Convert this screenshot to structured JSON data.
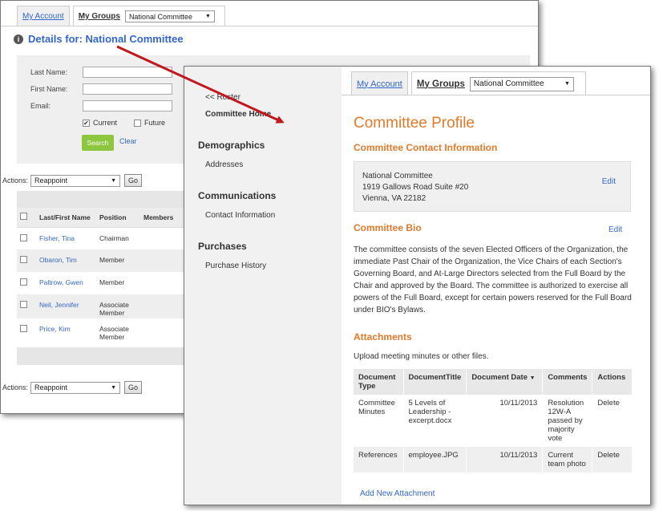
{
  "back": {
    "tabs": {
      "my_account": "My Account",
      "my_groups": "My Groups",
      "group_select": "National Committee"
    },
    "details_title": "Details for: National Committee",
    "form": {
      "last_name_label": "Last Name:",
      "first_name_label": "First Name:",
      "email_label": "Email:",
      "current_label": "Current",
      "future_label": "Future",
      "search_label": "Search",
      "clear_label": "Clear"
    },
    "actions_label": "Actions:",
    "actions_value": "Reappoint",
    "go_label": "Go",
    "table": {
      "headers": [
        "Last/First Name",
        "Position",
        "Members"
      ],
      "rows": [
        {
          "name": "Fisher, Tina",
          "position": "Chairman"
        },
        {
          "name": "Obaron, Tim",
          "position": "Member"
        },
        {
          "name": "Paltrow, Gwen",
          "position": "Member"
        },
        {
          "name": "Neil, Jennifer",
          "position": "Associate Member"
        },
        {
          "name": "Price, Kim",
          "position": "Associate Member"
        }
      ]
    }
  },
  "front": {
    "tabs": {
      "my_account": "My Account",
      "my_groups": "My Groups",
      "group_select": "National Committee"
    },
    "sidebar": {
      "roster": "<< Roster",
      "committee_home": "Committee Home",
      "demographics": "Demographics",
      "addresses": "Addresses",
      "communications": "Communications",
      "contact_information": "Contact Information",
      "purchases": "Purchases",
      "purchase_history": "Purchase History"
    },
    "title": "Committee Profile",
    "contact": {
      "heading": "Committee Contact Information",
      "name": "National Committee",
      "address1": "1919 Gallows Road Suite #20",
      "address2": "Vienna, VA 22182",
      "edit": "Edit"
    },
    "bio": {
      "heading": "Committee Bio",
      "edit": "Edit",
      "text": "The committee consists of the seven Elected Officers of the Organization, the immediate Past Chair of the Organization, the Vice Chairs of each Section's Governing Board, and At-Large Directors selected from the Full Board by the Chair and approved by the Board. The committee is authorized to exercise all powers of the Full Board, except for certain powers reserved for the Full Board under BIO's Bylaws."
    },
    "attachments": {
      "heading": "Attachments",
      "subtext": "Upload meeting minutes or other files.",
      "headers": [
        "Document Type",
        "DocumentTitle",
        "Document Date",
        "Comments",
        "Actions"
      ],
      "rows": [
        {
          "type": "Committee Minutes",
          "title": "5 Levels of Leadership - excerpt.docx",
          "date": "10/11/2013",
          "comments": "Resolution 12W-A passed by majority vote",
          "action": "Delete"
        },
        {
          "type": "References",
          "title": "employee.JPG",
          "date": "10/11/2013",
          "comments": "Current team photo",
          "action": "Delete"
        }
      ],
      "add_new": "Add New Attachment"
    }
  }
}
